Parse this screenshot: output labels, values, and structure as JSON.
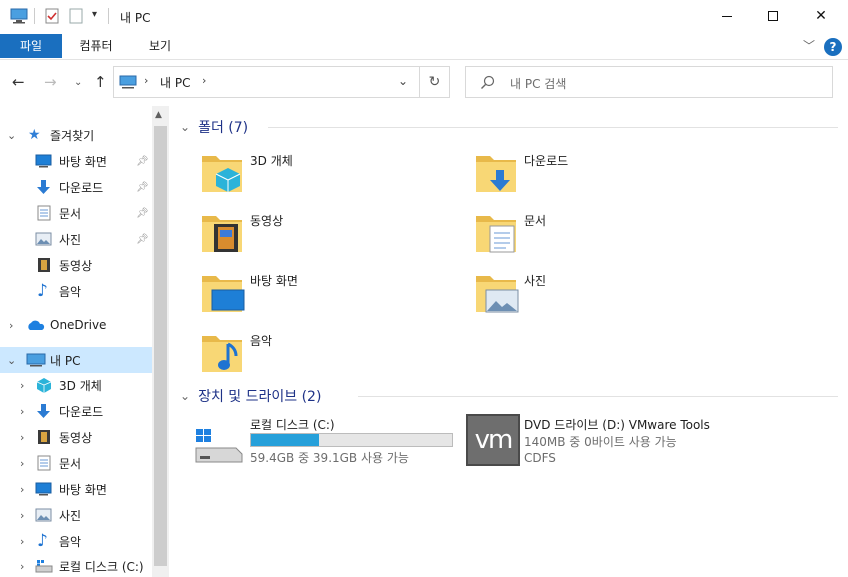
{
  "window": {
    "title": "내 PC"
  },
  "ribbon": {
    "tabs": [
      "파일",
      "컴퓨터",
      "보기"
    ]
  },
  "address": {
    "path_label": "내 PC",
    "search_placeholder": "내 PC 검색"
  },
  "nav_pane": {
    "quick_access": "즐겨찾기",
    "quick_items": [
      "바탕 화면",
      "다운로드",
      "문서",
      "사진",
      "동영상",
      "음악"
    ],
    "onedrive": "OneDrive",
    "this_pc": "내 PC",
    "pc_items": [
      "3D 개체",
      "다운로드",
      "동영상",
      "문서",
      "바탕 화면",
      "사진",
      "음악",
      "로컬 디스크 (C:)"
    ]
  },
  "content": {
    "folders_header": "폴더 (7)",
    "folders": [
      "3D 개체",
      "다운로드",
      "동영상",
      "문서",
      "바탕 화면",
      "사진",
      "음악"
    ],
    "devices_header": "장치 및 드라이브 (2)",
    "drive_c": {
      "name": "로컬 디스크 (C:)",
      "free_text": "59.4GB 중 39.1GB 사용 가능",
      "used_fraction": 0.34
    },
    "drive_d": {
      "name": "DVD 드라이브 (D:) VMware Tools",
      "free_text": "140MB 중 0바이트 사용 가능",
      "fs": "CDFS",
      "logo_text": "vm"
    }
  },
  "colors": {
    "accent": "#1a6fbf",
    "selected": "#cce8ff",
    "folder": "#f8d775",
    "header": "#1e3287"
  }
}
